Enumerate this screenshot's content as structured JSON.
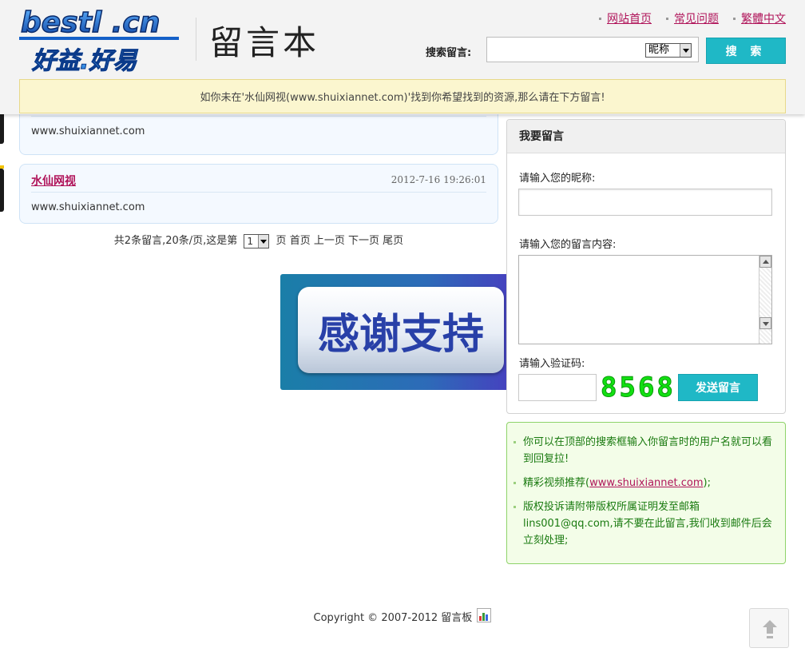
{
  "header": {
    "logo_text_top": "bestl .cn",
    "logo_text_bottom": "好益.好易",
    "site_title": "留言本",
    "nav": [
      {
        "label": "网站首页"
      },
      {
        "label": "常见问题"
      },
      {
        "label": "繁體中文"
      }
    ],
    "search": {
      "label": "搜索留言:",
      "value": "",
      "scope_selected": "昵称",
      "button_label": "搜 索"
    },
    "notice": "如你未在'水仙网视(www.shuixiannet.com)'找到你希望找到的资源,那么请在下方留言!"
  },
  "messages": [
    {
      "name": "",
      "time": "",
      "content": "www.shuixiannet.com"
    },
    {
      "name": "水仙网视",
      "time": "2012-7-16 19:26:01",
      "content": "www.shuixiannet.com"
    }
  ],
  "pagination": {
    "prefix": "共2条留言,20条/页,这是第",
    "current_page": "1",
    "suffix": "页",
    "first": "首页",
    "prev": "上一页",
    "next": "下一页",
    "last": "尾页"
  },
  "thanks_banner": "感谢支持",
  "form": {
    "title": "我要留言",
    "nickname_label": "请输入您的昵称:",
    "nickname_value": "",
    "content_label": "请输入您的留言内容:",
    "content_value": "",
    "captcha_label": "请输入验证码:",
    "captcha_value": "",
    "captcha_code": "8568",
    "submit_label": "发送留言"
  },
  "tips": {
    "tip1": "你可以在顶部的搜索框输入你留言时的用户名就可以看到回复拉!",
    "tip2_prefix": "精彩视频推荐(",
    "tip2_link": "www.shuixiannet.com",
    "tip2_suffix": ");",
    "tip3": "版权投诉请附带版权所属证明发至邮箱lins001@qq.com,请不要在此留言,我们收到邮件后会立刻处理;"
  },
  "footer": {
    "copyright": "Copyright © 2007-2012 留言板"
  },
  "icons": {
    "stats": "cnzz-stats-icon",
    "back_to_top": "arrow-up-icon"
  },
  "colors": {
    "accent": "#1fb8c6",
    "link": "#b0145a",
    "tip_text": "#1a7a10"
  }
}
